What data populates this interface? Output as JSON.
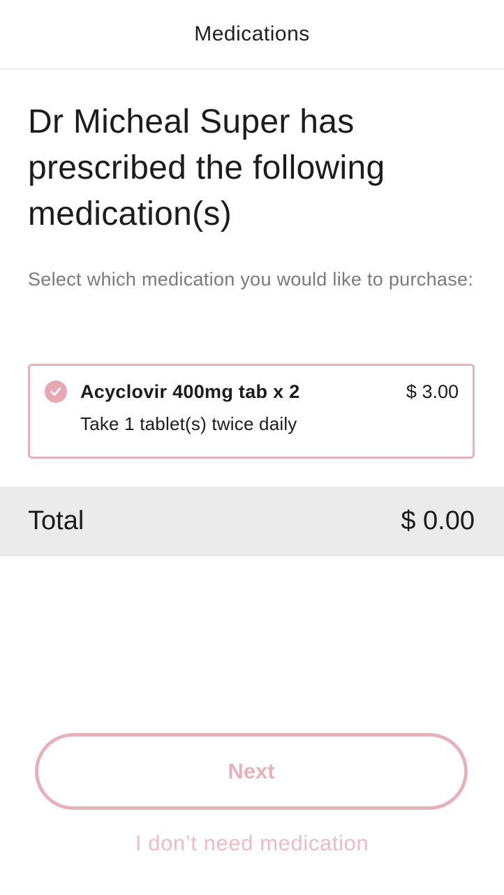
{
  "header": {
    "title": "Medications"
  },
  "main": {
    "headline": "Dr Micheal Super has prescribed the following medication(s)",
    "instruction": "Select which medication you would like to purchase:",
    "medications": [
      {
        "name": "Acyclovir 400mg tab x 2",
        "price": "$ 3.00",
        "instructions": "Take 1 tablet(s) twice daily",
        "selected": true,
        "check_icon": "check-circle-icon"
      }
    ],
    "total_label": "Total",
    "total_value": "$ 0.00"
  },
  "actions": {
    "next_label": "Next",
    "skip_label": "I don’t need medication"
  },
  "colors": {
    "accent": "#e6b2ba",
    "total_bar_bg": "#ebebeb",
    "muted_text": "#7a7a7a"
  }
}
